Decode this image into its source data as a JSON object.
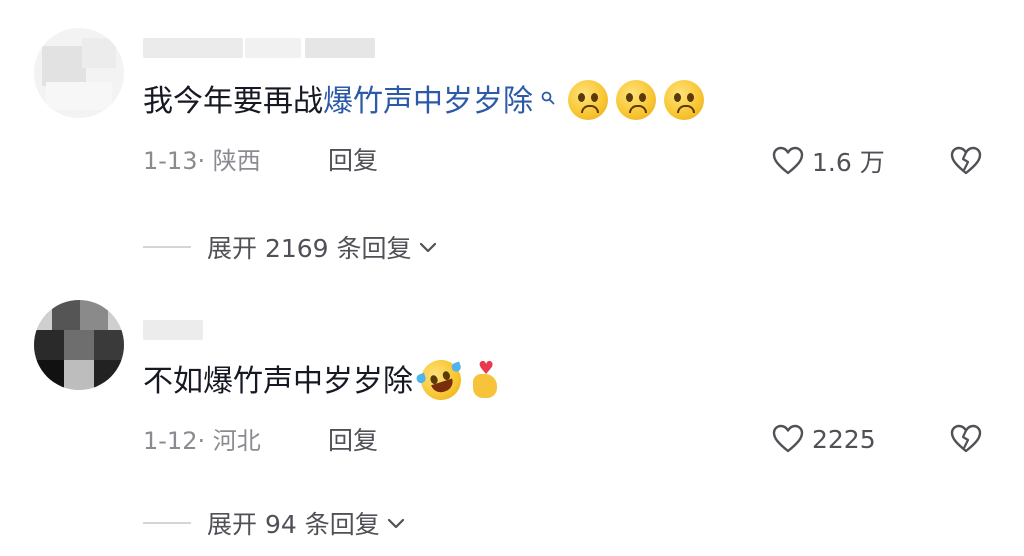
{
  "comments": [
    {
      "text_plain": "我今年要再战",
      "text_keyword": "爆竹声中岁岁除",
      "date": "1-13",
      "location": "陕西",
      "reply_label": "回复",
      "like_count": "1.6 万",
      "expand_prefix": "展开",
      "expand_count": "2169",
      "expand_suffix": "条回复",
      "emojis": [
        "pleading-face-emoji",
        "pleading-face-emoji",
        "pleading-face-emoji"
      ]
    },
    {
      "text_plain": "不如爆竹声中岁岁除",
      "date": "1-12",
      "location": "河北",
      "reply_label": "回复",
      "like_count": "2225",
      "expand_prefix": "展开",
      "expand_count": "94",
      "expand_suffix": "条回复",
      "emojis": [
        "rolling-on-floor-laughing-emoji",
        "finger-heart-emoji"
      ]
    }
  ],
  "icons": {
    "search": "search-icon",
    "like": "heart-outline-icon",
    "dislike": "broken-heart-icon",
    "expand": "chevron-down-icon"
  },
  "colors": {
    "text": "#161823",
    "keyword": "#2d5aa8",
    "meta": "#8a8b91",
    "action": "#505157"
  }
}
